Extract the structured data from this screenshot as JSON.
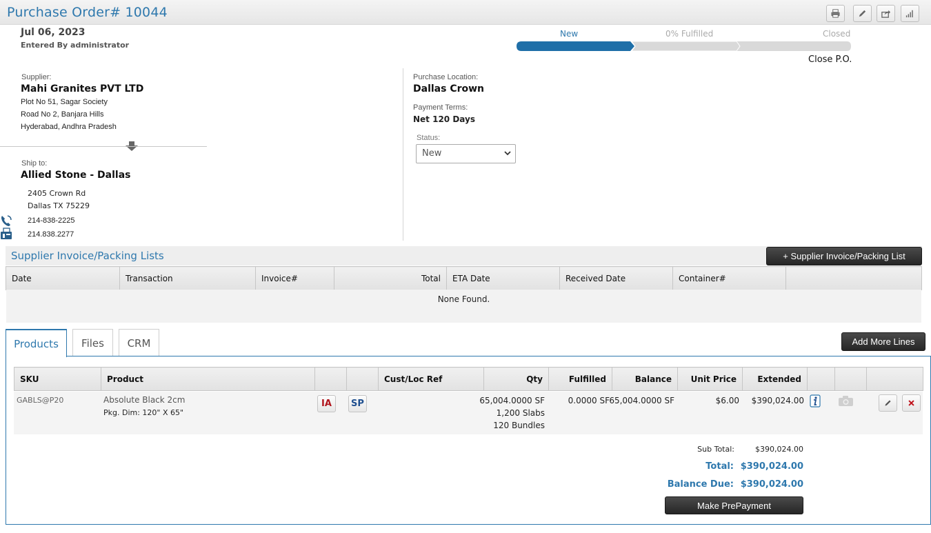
{
  "header": {
    "title": "Purchase Order# 10044",
    "tools": [
      "printer-icon",
      "edit-icon",
      "share-icon",
      "chart-icon"
    ]
  },
  "order": {
    "date": "Jul 06, 2023",
    "entered_by": "Entered By administrator"
  },
  "progress": {
    "stages": [
      "New",
      "0% Fulfilled",
      "Closed"
    ],
    "active_stage": "New",
    "close_label": "Close P.O."
  },
  "supplier": {
    "label": "Supplier:",
    "name": "Mahi Granites PVT LTD",
    "address": [
      "Plot No 51, Sagar Society",
      "Road No 2, Banjara Hills",
      "Hyderabad, Andhra Pradesh"
    ]
  },
  "ship_to": {
    "label": "Ship to:",
    "name": "Allied Stone - Dallas",
    "address": [
      "2405 Crown Rd",
      "Dallas TX 75229"
    ],
    "phone": "214-838-2225",
    "fax": "214.838.2277"
  },
  "details": {
    "location_label": "Purchase Location:",
    "location": "Dallas Crown",
    "terms_label": "Payment Terms:",
    "terms": "Net 120 Days",
    "status_label": "Status:",
    "status_value": "New"
  },
  "invoices": {
    "title": "Supplier Invoice/Packing Lists",
    "add_button": "+ Supplier Invoice/Packing List",
    "columns": [
      "Date",
      "Transaction",
      "Invoice#",
      "Total",
      "ETA Date",
      "Received Date",
      "Container#",
      ""
    ],
    "empty_text": "None Found."
  },
  "tabs": [
    "Products",
    "Files",
    "CRM"
  ],
  "products": {
    "add_button": "Add More Lines",
    "columns": [
      "SKU",
      "Product",
      "",
      "",
      "Cust/Loc Ref",
      "Qty",
      "Fulfilled",
      "Balance",
      "Unit Price",
      "Extended",
      "",
      "",
      ""
    ],
    "rows": [
      {
        "sku": "GABLS@P20",
        "product": "Absolute Black 2cm",
        "pkg": "Pkg. Dim: 120\" X 65\"",
        "ia": "IA",
        "sp": "SP",
        "qty": [
          "65,004.0000 SF",
          "1,200 Slabs",
          "120 Bundles"
        ],
        "fulfilled": "0.0000 SF",
        "balance": "65,004.0000 SF",
        "unit_price": "$6.00",
        "extended": "$390,024.00"
      }
    ]
  },
  "totals": {
    "subtotal_label": "Sub Total:",
    "subtotal": "$390,024.00",
    "total_label": "Total:",
    "total": "$390,024.00",
    "balance_label": "Balance Due:",
    "balance": "$390,024.00",
    "prepay_button": "Make PrePayment"
  },
  "colors": {
    "accent": "#2e78ad",
    "progress_active": "#1f6fa8",
    "progress_inactive": "#d9d9d9",
    "danger": "#c0141c"
  }
}
